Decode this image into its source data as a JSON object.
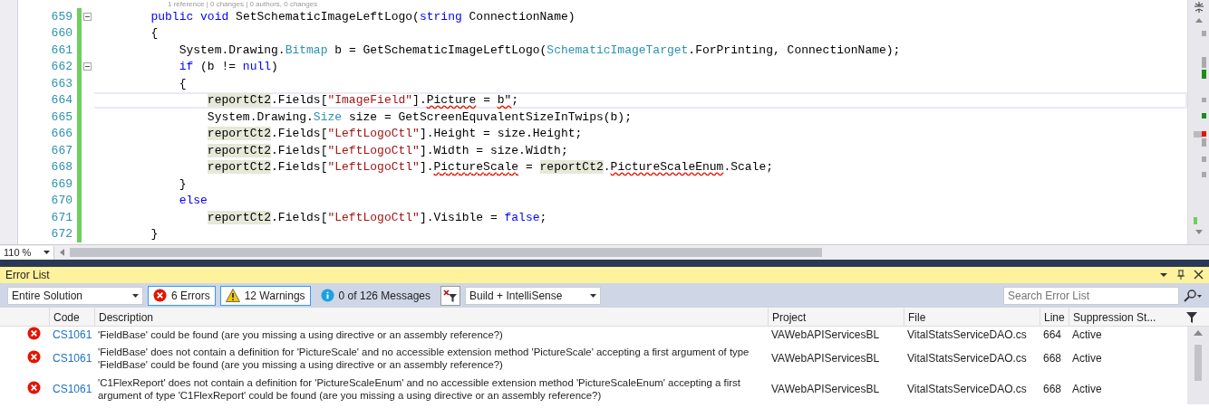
{
  "editor": {
    "codelens": "1 reference | 0 changes | 0 authors, 0 changes",
    "lines": [
      {
        "number": "659",
        "foldable": true,
        "changed": true,
        "current": false,
        "tokens": [
          {
            "text": "        public",
            "kind": "keyword"
          },
          {
            "text": " void",
            "kind": "keyword"
          },
          {
            "text": " SetSchematicImageLeftLogo(",
            "kind": "plain"
          },
          {
            "text": "string",
            "kind": "keyword"
          },
          {
            "text": " ConnectionName)",
            "kind": "plain"
          }
        ]
      },
      {
        "number": "660",
        "foldable": false,
        "changed": true,
        "current": false,
        "tokens": [
          {
            "text": "        {",
            "kind": "plain"
          }
        ]
      },
      {
        "number": "661",
        "foldable": false,
        "changed": true,
        "current": false,
        "tokens": [
          {
            "text": "            System.Drawing.",
            "kind": "plain"
          },
          {
            "text": "Bitmap",
            "kind": "type"
          },
          {
            "text": " b = GetSchematicImageLeftLogo(",
            "kind": "plain"
          },
          {
            "text": "SchematicImageTarget",
            "kind": "type"
          },
          {
            "text": ".ForPrinting, ConnectionName);",
            "kind": "plain"
          }
        ]
      },
      {
        "number": "662",
        "foldable": true,
        "changed": true,
        "current": false,
        "tokens": [
          {
            "text": "            if",
            "kind": "keyword"
          },
          {
            "text": " (b != ",
            "kind": "plain"
          },
          {
            "text": "null",
            "kind": "keyword"
          },
          {
            "text": ")",
            "kind": "plain"
          }
        ]
      },
      {
        "number": "663",
        "foldable": false,
        "changed": true,
        "current": false,
        "tokens": [
          {
            "text": "            {",
            "kind": "plain"
          }
        ]
      },
      {
        "number": "664",
        "foldable": false,
        "changed": true,
        "current": true,
        "tokens": [
          {
            "text": "                reportCt2",
            "kind": "reference"
          },
          {
            "text": ".Fields[",
            "kind": "plain"
          },
          {
            "text": "\"ImageField\"",
            "kind": "string"
          },
          {
            "text": "].",
            "kind": "plain"
          },
          {
            "text": "Picture",
            "kind": "error"
          },
          {
            "text": " = ",
            "kind": "plain"
          },
          {
            "text": "b\"",
            "kind": "error"
          },
          {
            "text": ";",
            "kind": "plain"
          }
        ]
      },
      {
        "number": "665",
        "foldable": false,
        "changed": true,
        "current": false,
        "tokens": [
          {
            "text": "                System.Drawing.",
            "kind": "plain"
          },
          {
            "text": "Size",
            "kind": "type"
          },
          {
            "text": " size = GetScreenEquvalentSizeInTwips(b);",
            "kind": "plain"
          }
        ]
      },
      {
        "number": "666",
        "foldable": false,
        "changed": true,
        "current": false,
        "tokens": [
          {
            "text": "                reportCt2",
            "kind": "reference"
          },
          {
            "text": ".Fields[",
            "kind": "plain"
          },
          {
            "text": "\"LeftLogoCtl\"",
            "kind": "string"
          },
          {
            "text": "].Height = size.Height;",
            "kind": "plain"
          }
        ]
      },
      {
        "number": "667",
        "foldable": false,
        "changed": true,
        "current": false,
        "tokens": [
          {
            "text": "                reportCt2",
            "kind": "reference"
          },
          {
            "text": ".Fields[",
            "kind": "plain"
          },
          {
            "text": "\"LeftLogoCtl\"",
            "kind": "string"
          },
          {
            "text": "].Width = size.Width;",
            "kind": "plain"
          }
        ]
      },
      {
        "number": "668",
        "foldable": false,
        "changed": true,
        "current": false,
        "tokens": [
          {
            "text": "                reportCt2",
            "kind": "reference"
          },
          {
            "text": ".Fields[",
            "kind": "plain"
          },
          {
            "text": "\"LeftLogoCtl\"",
            "kind": "string"
          },
          {
            "text": "].",
            "kind": "plain"
          },
          {
            "text": "PictureScale",
            "kind": "error"
          },
          {
            "text": " = ",
            "kind": "plain"
          },
          {
            "text": "reportCt2",
            "kind": "reference"
          },
          {
            "text": ".",
            "kind": "plain"
          },
          {
            "text": "PictureScaleEnum",
            "kind": "error"
          },
          {
            "text": ".Scale;",
            "kind": "plain"
          }
        ]
      },
      {
        "number": "669",
        "foldable": false,
        "changed": true,
        "current": false,
        "tokens": [
          {
            "text": "            }",
            "kind": "plain"
          }
        ]
      },
      {
        "number": "670",
        "foldable": false,
        "changed": true,
        "current": false,
        "tokens": [
          {
            "text": "            else",
            "kind": "keyword"
          }
        ]
      },
      {
        "number": "671",
        "foldable": false,
        "changed": true,
        "current": false,
        "tokens": [
          {
            "text": "                reportCt2",
            "kind": "reference"
          },
          {
            "text": ".Fields[",
            "kind": "plain"
          },
          {
            "text": "\"LeftLogoCtl\"",
            "kind": "string"
          },
          {
            "text": "].Visible = ",
            "kind": "plain"
          },
          {
            "text": "false",
            "kind": "keyword"
          },
          {
            "text": ";",
            "kind": "plain"
          }
        ]
      },
      {
        "number": "672",
        "foldable": false,
        "changed": true,
        "current": false,
        "tokens": [
          {
            "text": "        }",
            "kind": "plain"
          }
        ]
      }
    ],
    "zoom": "110 %"
  },
  "error_list": {
    "title": "Error List",
    "scope": "Entire Solution",
    "filters": [
      {
        "kind": "error",
        "label": "6 Errors",
        "selected": true
      },
      {
        "kind": "warning",
        "label": "12 Warnings",
        "selected": true
      },
      {
        "kind": "message",
        "label": "0 of 126 Messages",
        "selected": false
      }
    ],
    "source": "Build + IntelliSense",
    "search": {
      "placeholder": "Search Error List"
    },
    "columns": [
      "Code",
      "Description",
      "Project",
      "File",
      "Line",
      "Suppression St..."
    ],
    "rows": [
      {
        "code": "CS1061",
        "description": "'FieldBase' could be found (are you missing a using directive or an assembly reference?)",
        "project": "VAWebAPIServicesBL",
        "file": "VitalStatsServiceDAO.cs",
        "line": "664",
        "suppression": "Active"
      },
      {
        "code": "CS1061",
        "description": "'FieldBase' does not contain a definition for 'PictureScale' and no accessible extension method 'PictureScale' accepting a first argument of type 'FieldBase' could be found (are you missing a using directive or an assembly reference?)",
        "project": "VAWebAPIServicesBL",
        "file": "VitalStatsServiceDAO.cs",
        "line": "668",
        "suppression": "Active"
      },
      {
        "code": "CS1061",
        "description": "'C1FlexReport' does not contain a definition for 'PictureScaleEnum' and no accessible extension method 'PictureScaleEnum' accepting a first argument of type 'C1FlexReport' could be found (are you missing a using directive or an assembly reference?)",
        "project": "VAWebAPIServicesBL",
        "file": "VitalStatsServiceDAO.cs",
        "line": "668",
        "suppression": "Active"
      }
    ]
  }
}
